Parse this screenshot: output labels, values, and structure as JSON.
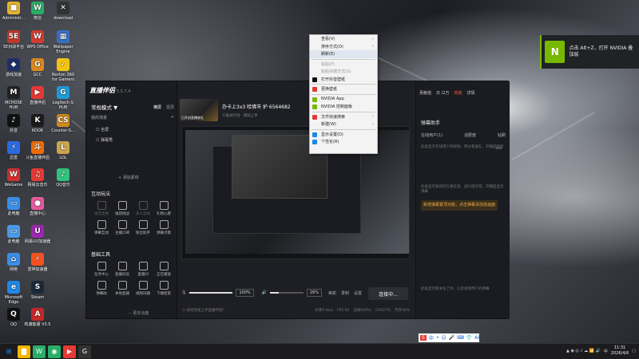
{
  "desktop_icons": [
    {
      "label": "Administr...",
      "color": "#e8b530",
      "glyph": "■"
    },
    {
      "label": "微信",
      "color": "#2aae67",
      "glyph": "W"
    },
    {
      "label": "download",
      "color": "#333333",
      "glyph": "✕"
    },
    {
      "label": "5E对战平台",
      "color": "#c0392b",
      "glyph": "5E"
    },
    {
      "label": "WPS Office",
      "color": "#d63b2f",
      "glyph": "W"
    },
    {
      "label": "Wallpaper Engine",
      "color": "#3a6fc4",
      "glyph": "▦"
    },
    {
      "label": "游戏加速",
      "color": "#1f2f6a",
      "glyph": "◆"
    },
    {
      "label": "GCC",
      "color": "#d98a1c",
      "glyph": "G"
    },
    {
      "label": "Norton 360 for Gamers",
      "color": "#f2c40f",
      "glyph": "✓"
    },
    {
      "label": "MCHOSE HUB",
      "color": "#222222",
      "glyph": "M"
    },
    {
      "label": "直播伴侣",
      "color": "#e53935",
      "glyph": "▶"
    },
    {
      "label": "Logitech G HUB",
      "color": "#1e9ad6",
      "glyph": "G"
    },
    {
      "label": "抖音",
      "color": "#111111",
      "glyph": "♪"
    },
    {
      "label": "KOOK",
      "color": "#1b1b1b",
      "glyph": "K"
    },
    {
      "label": "Counter-S...",
      "color": "#d18b1d",
      "glyph": "CS"
    },
    {
      "label": "迅雷",
      "color": "#2b6be0",
      "glyph": "⚡"
    },
    {
      "label": "斗鱼直播伴侣",
      "color": "#ef6c00",
      "glyph": "斗"
    },
    {
      "label": "LOL",
      "color": "#c8a44d",
      "glyph": "L"
    },
    {
      "label": "WeGame",
      "color": "#d32f2f",
      "glyph": "W"
    },
    {
      "label": "网易云音乐",
      "color": "#e53935",
      "glyph": "♫"
    },
    {
      "label": "QQ音乐",
      "color": "#31c27c",
      "glyph": "♪"
    },
    {
      "label": "此电脑",
      "color": "#3a8ee6",
      "glyph": "▭"
    },
    {
      "label": "直播中心",
      "color": "#e65a9e",
      "glyph": "●"
    },
    {
      "label": "此电脑",
      "color": "#4a9ae8",
      "glyph": "▭"
    },
    {
      "label": "网易UU加速器",
      "color": "#9c27b0",
      "glyph": "U"
    },
    {
      "label": "网络",
      "color": "#3a8ee6",
      "glyph": "⌂"
    },
    {
      "label": "雷神加速器",
      "color": "#f4511e",
      "glyph": "⚡"
    },
    {
      "label": "Microsoft Edge",
      "color": "#1e88e5",
      "glyph": "e"
    },
    {
      "label": "Steam",
      "color": "#1b2838",
      "glyph": "S"
    },
    {
      "label": "QQ",
      "color": "#111111",
      "glyph": "Q"
    },
    {
      "label": "鸣潮客服 V3.5",
      "color": "#c62828",
      "glyph": "A"
    }
  ],
  "nvidia_toast": {
    "text": "点击 Alt+Z，打开 NVIDIA 叠加层",
    "logo": "N"
  },
  "app": {
    "name": "直播伴侣",
    "version": "5.5.7.4",
    "mode_title": "常规模式 ▼",
    "mode_tabs": [
      "横屏",
      "竖屏"
    ],
    "scene_label": "我的场景",
    "scene_add": "+",
    "scenes": [
      "全屏",
      "弹幕秀"
    ],
    "add_material": "+ 添加素材",
    "interact_title": "互动玩法",
    "interact_tools": [
      {
        "label": "语音连线",
        "dim": true
      },
      {
        "label": "福袋挑战",
        "dim": false
      },
      {
        "label": "多人连线",
        "dim": true
      },
      {
        "label": "礼物心愿",
        "dim": false
      },
      {
        "label": "弹幕互动",
        "dim": false
      },
      {
        "label": "主播口碑",
        "dim": false
      },
      {
        "label": "粉丝助手",
        "dim": false
      },
      {
        "label": "弹幕点歌",
        "dim": false
      }
    ],
    "basic_title": "基础工具",
    "basic_tools": [
      {
        "label": "任务中心",
        "dim": false
      },
      {
        "label": "直播间设",
        "dim": false
      },
      {
        "label": "直播间",
        "dim": false
      },
      {
        "label": "正在播放",
        "dim": false
      },
      {
        "label": "弹幕助",
        "dim": false
      },
      {
        "label": "本地直播",
        "dim": false
      },
      {
        "label": "视频同播",
        "dim": false
      },
      {
        "label": "下播结束",
        "dim": false
      }
    ],
    "more_functions": "··· 更多功能",
    "room_title": "办卡上3x3 哈佛市 护 6564682",
    "room_sub": "三角洲行动 · 帮助上手 ",
    "room_thumb_caption": "已开启直播收礼",
    "mic_label": "麦克风",
    "mic_volume": "100%",
    "speaker_label": "扬声器",
    "speaker_volume": "26%",
    "ctrl_labels": [
      "美颜",
      "录制",
      "设置"
    ],
    "start_button": "连接中...",
    "status_left": "① 如何快速上手直播伴侣？",
    "status_items": [
      "码率0 kb/s",
      "FPS 60",
      "丢帧0(0%)",
      "CPU27%",
      "内存34%"
    ],
    "top_right_items": [
      "贡献值",
      "日 /2万",
      "热度",
      "详情"
    ],
    "danmu_title": "弹幕助手",
    "danmu_tabs": [
      "在线用户(1)",
      "话匣度",
      "钻刷"
    ],
    "online_text": "0.0",
    "online_sub": "此处显示在线用户的昵称、积分和送礼，开播后显示",
    "gift_text": "此处显示收到的礼物信息、送礼提示等，开播后显示弹幕",
    "notice": "新增弹幕置顶功能，点击弹幕添加进画面",
    "bottom_text": "此处显示新关注了你，以及进场用户的弹幕"
  },
  "context_menu": [
    {
      "label": "查看(V)",
      "arrow": true,
      "disabled": false,
      "icon": ""
    },
    {
      "label": "排序方式(O)",
      "arrow": true,
      "disabled": false,
      "icon": ""
    },
    {
      "label": "刷新(E)",
      "arrow": false,
      "disabled": false,
      "icon": "",
      "hl": true
    },
    {
      "sep": true
    },
    {
      "label": "粘贴(P)",
      "arrow": false,
      "disabled": true,
      "icon": ""
    },
    {
      "label": "粘贴快捷方式(S)",
      "arrow": false,
      "disabled": true,
      "icon": ""
    },
    {
      "label": "打开抖音壁纸",
      "arrow": false,
      "disabled": false,
      "icon": "#111111"
    },
    {
      "sep": true
    },
    {
      "label": "更换壁纸",
      "arrow": false,
      "disabled": false,
      "icon": "#e53935"
    },
    {
      "sep": true
    },
    {
      "label": "NVIDIA App",
      "arrow": false,
      "disabled": false,
      "icon": "#76b900"
    },
    {
      "label": "NVIDIA 控制面板",
      "arrow": false,
      "disabled": false,
      "icon": "#76b900"
    },
    {
      "sep": true
    },
    {
      "label": "文件快速搜索",
      "arrow": true,
      "disabled": false,
      "icon": "#e53935"
    },
    {
      "label": "新建(W)",
      "arrow": true,
      "disabled": false,
      "icon": ""
    },
    {
      "sep": true
    },
    {
      "label": "显示设置(D)",
      "arrow": false,
      "disabled": false,
      "icon": "#1e88e5"
    },
    {
      "label": "个性化(R)",
      "arrow": false,
      "disabled": false,
      "icon": "#1e88e5"
    }
  ],
  "taskbar": {
    "apps": [
      {
        "name": "start",
        "color": "#1e88e5",
        "glyph": "⊞"
      },
      {
        "name": "explorer",
        "color": "#f2b600",
        "glyph": "▇"
      },
      {
        "name": "wechat",
        "color": "#2aae67",
        "glyph": "W"
      },
      {
        "name": "wechat2",
        "color": "#2aae67",
        "glyph": "◉"
      },
      {
        "name": "zhibo",
        "color": "#e53935",
        "glyph": "▶"
      },
      {
        "name": "wegame",
        "color": "#333333",
        "glyph": "G"
      }
    ],
    "time": "11:31",
    "date": "2026/4/6",
    "lang": "中",
    "ime_items": [
      "S",
      "中",
      "•",
      "☺",
      "🎤",
      "⌨",
      "👕",
      "AI"
    ]
  }
}
